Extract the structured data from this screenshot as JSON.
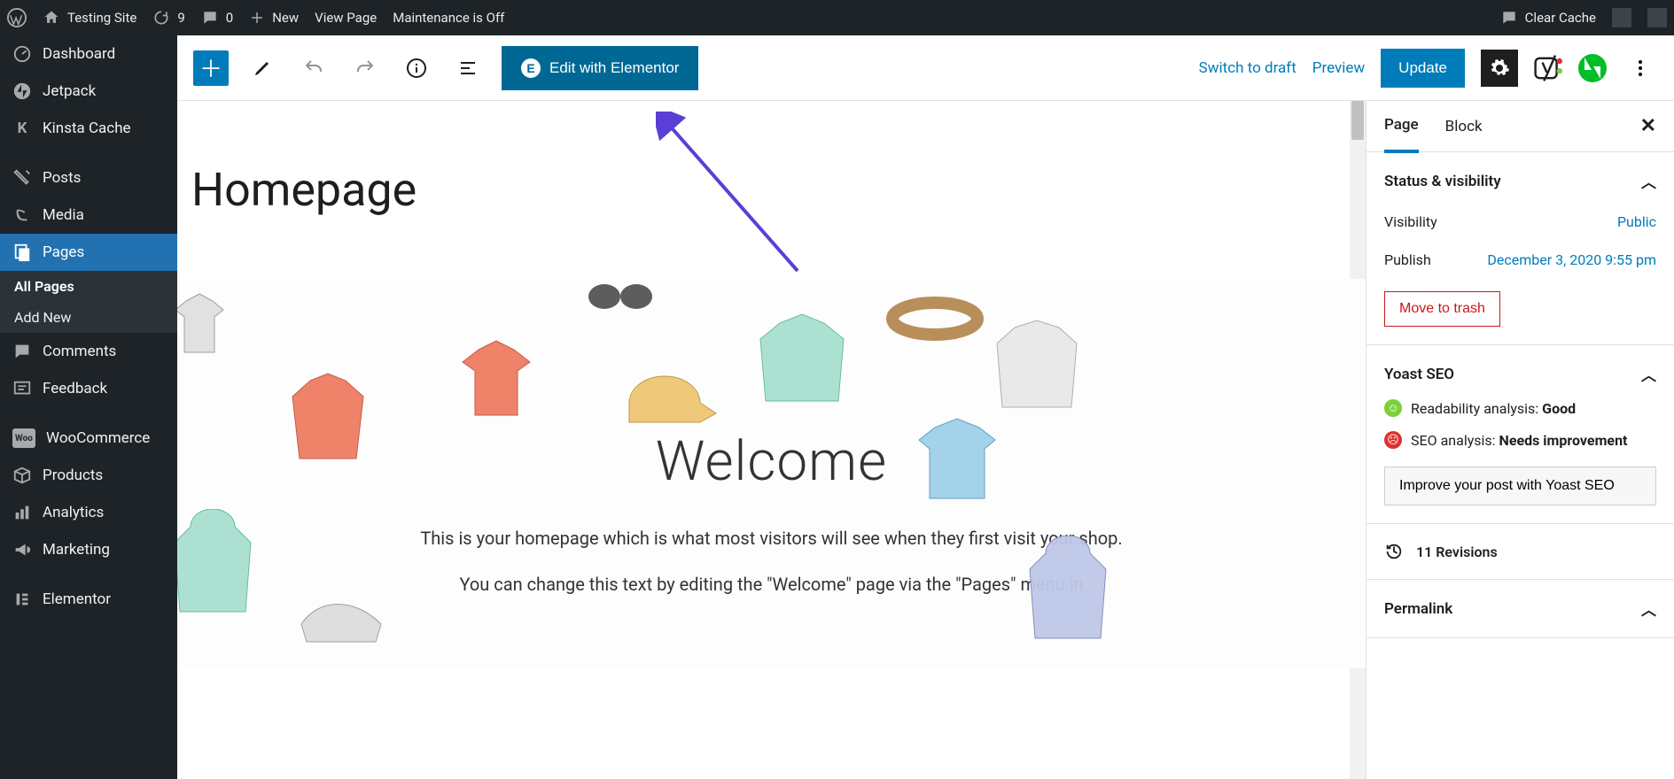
{
  "adminbar": {
    "site": "Testing Site",
    "updates": "9",
    "comments": "0",
    "new": "New",
    "view_page": "View Page",
    "maintenance": "Maintenance is Off",
    "clear_cache": "Clear Cache"
  },
  "sidebar": {
    "items": [
      {
        "label": "Dashboard"
      },
      {
        "label": "Jetpack"
      },
      {
        "label": "Kinsta Cache"
      },
      {
        "label": "Posts"
      },
      {
        "label": "Media"
      },
      {
        "label": "Pages"
      },
      {
        "label": "Comments"
      },
      {
        "label": "Feedback"
      },
      {
        "label": "WooCommerce"
      },
      {
        "label": "Products"
      },
      {
        "label": "Analytics"
      },
      {
        "label": "Marketing"
      },
      {
        "label": "Elementor"
      }
    ],
    "sub": {
      "all": "All Pages",
      "add": "Add New"
    }
  },
  "toolbar": {
    "elementor": "Edit with Elementor",
    "switch_draft": "Switch to draft",
    "preview": "Preview",
    "update": "Update"
  },
  "page": {
    "title": "Homepage",
    "hero_heading": "Welcome",
    "hero_p1": "This is your homepage which is what most visitors will see when they first visit your shop.",
    "hero_p2": "You can change this text by editing the \"Welcome\" page via the \"Pages\" menu in"
  },
  "inspector": {
    "tabs": {
      "page": "Page",
      "block": "Block"
    },
    "status_heading": "Status & visibility",
    "visibility_label": "Visibility",
    "visibility_value": "Public",
    "publish_label": "Publish",
    "publish_value": "December 3, 2020 9:55 pm",
    "trash": "Move to trash",
    "yoast_heading": "Yoast SEO",
    "readability_label": "Readability analysis: ",
    "readability_value": "Good",
    "seo_label": "SEO analysis: ",
    "seo_value": "Needs improvement",
    "improve": "Improve your post with Yoast SEO",
    "revisions": "11 Revisions",
    "permalink": "Permalink"
  }
}
